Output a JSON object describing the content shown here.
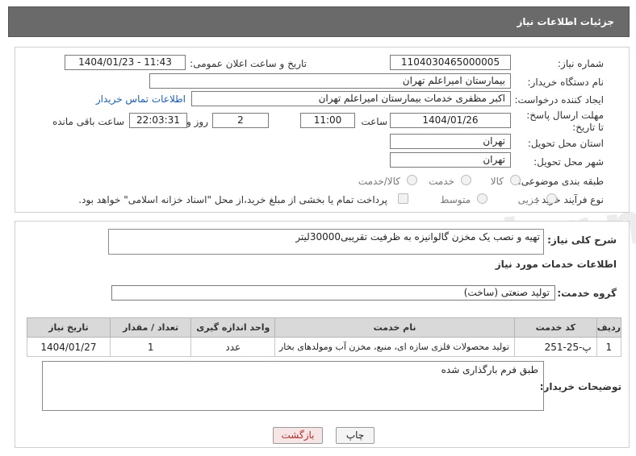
{
  "header": {
    "title": "جزئیات اطلاعات نیاز"
  },
  "fields": {
    "need_number_label": "شماره نیاز:",
    "need_number": "1104030465000005",
    "announce_label": "تاریخ و ساعت اعلان عمومی:",
    "announce_value": "1404/01/23 - 11:43",
    "buyer_org_label": "نام دستگاه خریدار:",
    "buyer_org": "بیمارستان امیراعلم تهران",
    "creator_label": "ایجاد کننده درخواست:",
    "creator": "اکبر مظفری خدمات بیمارستان امیراعلم تهران",
    "contact_link": "اطلاعات تماس خریدار",
    "deadline_label": "مهلت ارسال پاسخ: تا تاریخ:",
    "deadline_date": "1404/01/26",
    "time_label": "ساعت",
    "deadline_time": "11:00",
    "days_value": "2",
    "days_label": "روز و",
    "remaining_time": "22:03:31",
    "remaining_label": "ساعت باقی مانده",
    "province_label": "استان محل تحویل:",
    "province": "تهران",
    "city_label": "شهر محل تحویل:",
    "city": "تهران",
    "category_label": "طبقه بندی موضوعی:",
    "category_options": [
      "کالا",
      "خدمت",
      "کالا/خدمت"
    ],
    "process_label": "نوع فرآیند خرید :",
    "process_options": [
      "جزیی",
      "متوسط"
    ],
    "payment_note": "پرداخت تمام یا بخشی از مبلغ خرید،از محل \"اسناد خزانه اسلامی\" خواهد بود."
  },
  "summary": {
    "label": "شرح کلی نیاز:",
    "value": "تهیه و نصب یک مخزن گالوانیزه به ظرفیت تقریبی30000لیتر"
  },
  "services": {
    "section_title": "اطلاعات خدمات مورد نیاز",
    "group_label": "گروه خدمت:",
    "group_value": "تولید صنعتی (ساخت)",
    "table": {
      "headers": [
        "ردیف",
        "کد خدمت",
        "نام خدمت",
        "واحد اندازه گیری",
        "تعداد / مقدار",
        "تاریخ نیاز"
      ],
      "rows": [
        [
          "1",
          "پ-25-251",
          "تولید محصولات فلزی سازه ای، منبع، مخزن آب ومولدهای بخار",
          "عدد",
          "1",
          "1404/01/27"
        ]
      ]
    }
  },
  "buyer_notes": {
    "label": "توضیحات خریدار:",
    "value": "طبق فرم بارگذاری شده"
  },
  "buttons": {
    "print": "چاپ",
    "back": "بازگشت"
  },
  "watermark": "AriaTender.neT",
  "colors": {
    "header_bg": "#6a6a6a",
    "link": "#1a5fb4",
    "back_btn_bg": "#f7e4e4",
    "print_btn_bg": "#f4f4f4"
  }
}
